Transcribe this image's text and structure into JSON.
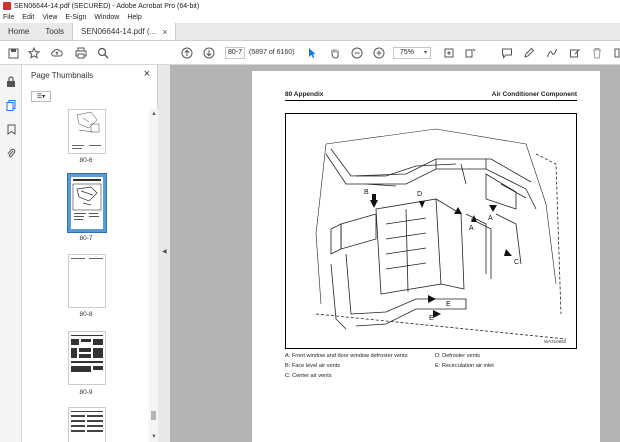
{
  "window": {
    "title": "SEN06644-14.pdf (SECURED) - Adobe Acrobat Pro (64-bit)"
  },
  "menu": [
    "File",
    "Edit",
    "View",
    "E-Sign",
    "Window",
    "Help"
  ],
  "tabs": [
    {
      "label": "Home"
    },
    {
      "label": "Tools"
    },
    {
      "label": "SEN06644-14.pdf (...",
      "close": "×"
    }
  ],
  "toolbar": {
    "page_value": "80-7",
    "page_count": "(5897 of 6160)",
    "zoom": "75%"
  },
  "panel": {
    "title": "Page Thumbnails",
    "close": "×",
    "thumbnails": [
      {
        "label": "80-6"
      },
      {
        "label": "80-7",
        "selected": true
      },
      {
        "label": "80-8"
      },
      {
        "label": "80-9"
      }
    ]
  },
  "document": {
    "header_left": "80 Appendix",
    "header_right": "Air Conditioner Component",
    "figure_code": "WA310650",
    "figure_labels": {
      "a": "A",
      "b": "B",
      "c": "C",
      "d": "D",
      "e": "E"
    },
    "captions": [
      "A: Front window and door window defroster vents",
      "D: Defroster vents",
      "B: Face level air vents",
      "E: Recirculation air inlet",
      "C: Center air vents"
    ]
  },
  "colors": {
    "accent": "#1473e6",
    "selected_thumb": "#5b9bd5",
    "docarea_bg": "#b4b4b4",
    "app_icon": "#d32f2f"
  }
}
